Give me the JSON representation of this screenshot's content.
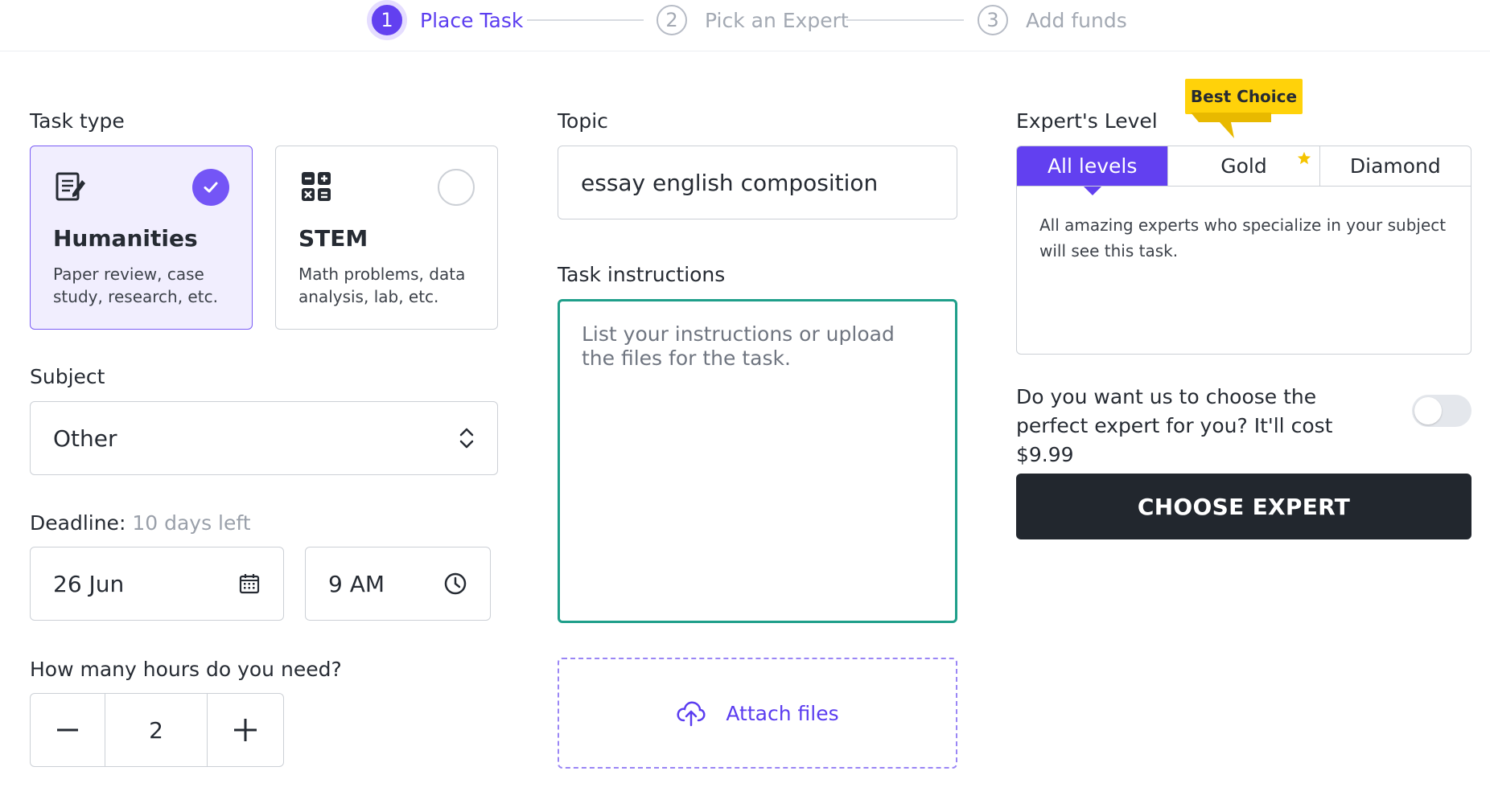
{
  "stepper": {
    "steps": [
      {
        "num": "1",
        "label": "Place Task",
        "active": true
      },
      {
        "num": "2",
        "label": "Pick an Expert",
        "active": false
      },
      {
        "num": "3",
        "label": "Add funds",
        "active": false
      }
    ]
  },
  "task_type": {
    "label": "Task type",
    "options": [
      {
        "title": "Humanities",
        "desc": "Paper review, case study, research, etc.",
        "selected": true,
        "icon": "document-pen-icon"
      },
      {
        "title": "STEM",
        "desc": "Math problems, data analysis, lab, etc.",
        "selected": false,
        "icon": "calculator-icon"
      }
    ]
  },
  "subject": {
    "label": "Subject",
    "value": "Other",
    "icon": "chevron-up-down-icon"
  },
  "deadline": {
    "label": "Deadline:",
    "remaining": "10 days left",
    "date": "26 Jun",
    "time": "9 AM",
    "date_icon": "calendar-icon",
    "time_icon": "clock-icon"
  },
  "hours": {
    "label": "How many hours do you need?",
    "value": "2",
    "decrement_icon": "minus-icon",
    "increment_icon": "plus-icon"
  },
  "topic": {
    "label": "Topic",
    "value": "essay english composition"
  },
  "instructions": {
    "label": "Task instructions",
    "placeholder": "List your instructions or upload the files for the task."
  },
  "attach": {
    "label": "Attach files",
    "icon": "cloud-upload-icon"
  },
  "expert_level": {
    "label": "Expert's Level",
    "badge": "Best Choice",
    "tabs": [
      {
        "label": "All levels",
        "active": true
      },
      {
        "label": "Gold",
        "active": false,
        "icon": "star-icon"
      },
      {
        "label": "Diamond",
        "active": false
      }
    ],
    "description": "All amazing experts who specialize in your subject will see this task."
  },
  "auto_choose": {
    "text": "Do you want us to choose the perfect expert for you? It'll cost $9.99",
    "enabled": false
  },
  "choose_button": {
    "label": "CHOOSE EXPERT"
  },
  "colors": {
    "accent": "#6240f0",
    "focus": "#1f9f8a",
    "badge": "#ffd20a",
    "button": "#22272e"
  }
}
